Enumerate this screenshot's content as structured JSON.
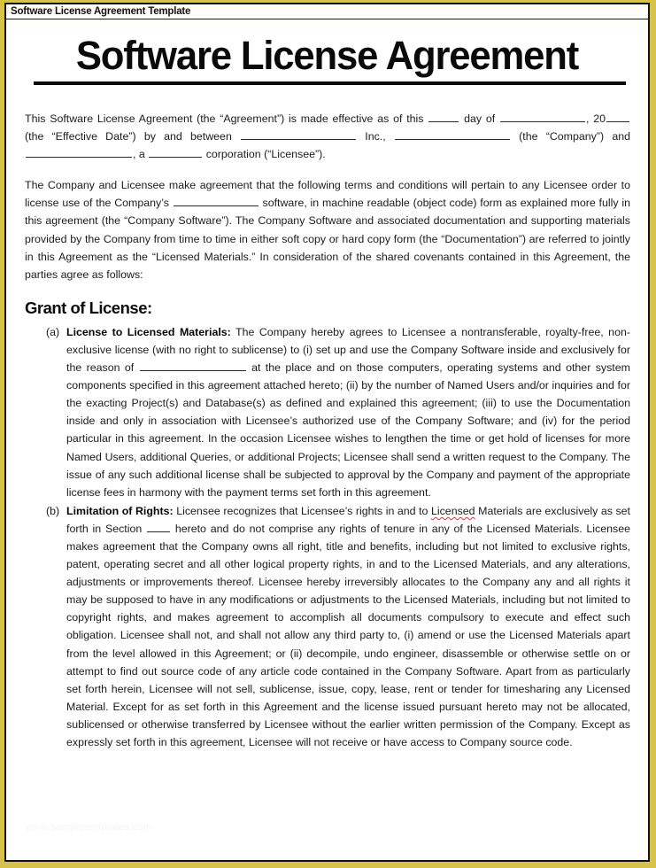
{
  "window": {
    "header_title": "Software License Agreement Template",
    "frame_color": "#d8c34a",
    "page_border_color": "#111111",
    "text_color": "#1b1b1b"
  },
  "document": {
    "title": "Software License Agreement",
    "paragraphs": {
      "intro_a": "This Software License Agreement (the “Agreement”) is made effective as of this",
      "intro_b": "day of",
      "intro_c": ", 20",
      "intro_d": "(the “Effective Date”) by and between",
      "intro_e": "Inc.,",
      "intro_f": "(the “Company”) and",
      "intro_g": ", a",
      "intro_h": "corporation (“Licensee”).",
      "recital_a": "The Company and Licensee make agreement that the following terms and conditions will pertain to any Licensee order to license use of the Company’s",
      "recital_b": "software, in machine readable (object code) form  as explained more fully in this agreement (the “Company Software”). The Company Software and associated documentation and supporting materials provided by the Company from time to time in either soft copy or hard copy form (the “Documentation”) are referred to jointly in this Agreement as the “Licensed Materials.” In consideration of the shared covenants contained in this Agreement, the parties agree as follows:"
    },
    "section_heading": "Grant of License:",
    "clauses": [
      {
        "marker": "(a)",
        "title": "License to Licensed Materials:",
        "body_a": "The Company hereby agrees to Licensee a nontransferable, royalty-free, non-exclusive license (with no right to sublicense) to (i) set up and use the Company Software inside and exclusively for  the reason of",
        "body_b": "at the place and on those computers, operating systems and other  system  components specified in this agreement attached hereto; (ii) by the number of Named Users and/or inquiries and for  the exacting  Project(s) and Database(s) as defined and explained this agreement; (iii) to use the Documentation inside and only in association with Licensee’s authorized use of the Company Software; and (iv) for  the period  particular in this agreement. In the occasion Licensee wishes to lengthen the time or get hold of licenses for more Named Users, additional Queries, or additional Projects; Licensee shall send a written request to the Company. The issue of any such additional license shall be subjected to approval by the Company and payment of the appropriate license fees in harmony with the payment terms set forth in this agreement."
      },
      {
        "marker": "(b)",
        "title": "Limitation of Rights:",
        "body_a": "Licensee recognizes that Licensee’s rights in and to",
        "misspelled_word": "Licensed",
        "body_b": "Materials are exclusively as set forth in Section",
        "body_c": "hereto and do not comprise any rights of tenure in any of the Licensed Materials. Licensee makes agreement that the Company owns all right, title and benefits, including but not limited to exclusive rights, patent, operating secret and all other logical property rights, in and to the Licensed Materials, and any alterations, adjustments or improvements thereof. Licensee hereby irreversibly allocates to the Company any and all rights it may be supposed to have in any modifications or adjustments to the Licensed Materials, including but not limited to copyright rights, and makes agreement to accomplish all documents compulsory to execute and effect such obligation. Licensee shall not, and shall not allow any third party to, (i) amend or use the Licensed Materials apart from the level allowed in this Agreement; or (ii) decompile, undo engineer, disassemble or otherwise settle on or attempt to find out source code of any article code contained in the Company Software. Apart from as particularly set forth herein, Licensee will not sell, sublicense, issue, copy, lease, rent or tender for timesharing any Licensed Material. Except for as set forth in this Agreement and the license issued pursuant hereto may not be allocated, sublicensed or otherwise transferred by Licensee without the earlier written permission of the Company. Except as expressly set forth in this agreement, Licensee will not receive or have access to Company source code."
      }
    ],
    "watermark": "www.sampletemplates.com"
  }
}
